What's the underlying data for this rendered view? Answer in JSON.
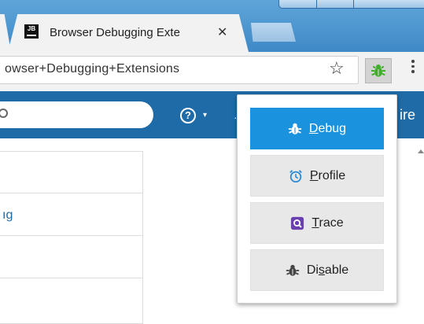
{
  "browser": {
    "tab": {
      "favicon_text": "JB",
      "title": "Browser Debugging Exte",
      "close_glyph": "✕"
    },
    "address_bar": {
      "url": "owser+Debugging+Extensions"
    },
    "star_icon": "☆",
    "extension_icon": "bug-icon"
  },
  "page": {
    "nav": {
      "help_glyph": "?",
      "help_caret": "▾",
      "partial_text": "ire"
    },
    "side_list": {
      "partial_link": "ıg"
    }
  },
  "popup": {
    "items": [
      {
        "pre": "",
        "u": "D",
        "post": "ebug",
        "icon": "bug-icon",
        "active": true
      },
      {
        "pre": "",
        "u": "P",
        "post": "rofile",
        "icon": "alarm-clock-icon",
        "active": false
      },
      {
        "pre": "",
        "u": "T",
        "post": "race",
        "icon": "trace-icon",
        "active": false
      },
      {
        "pre": "Di",
        "u": "s",
        "post": "able",
        "icon": "bug-icon",
        "active": false
      }
    ]
  },
  "colors": {
    "navbar": "#1f6ba8",
    "active_button": "#1b92de",
    "extension_green": "#3fae29",
    "trace_purple": "#6a3fb0",
    "profile_blue": "#2a8ad8"
  }
}
